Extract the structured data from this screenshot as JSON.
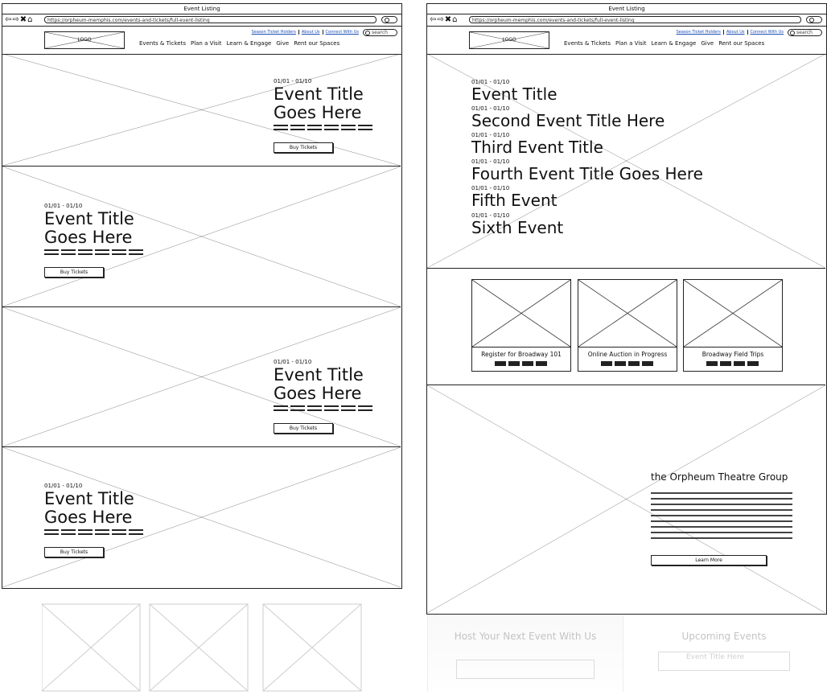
{
  "browser": {
    "title": "Event Listing",
    "left_url": "https://orpheum-memphis.com/events-and-tickets/full-event-listing",
    "right_url": "https://orpheum-memphis.com/events-and-tickets/full-event-listing"
  },
  "header": {
    "logo": "LOGO",
    "utility_links": [
      "Season Ticket Holders",
      "About Us",
      "Connect With Us"
    ],
    "search_placeholder": "search",
    "nav": [
      "Events & Tickets",
      "Plan a Visit",
      "Learn & Engage",
      "Give",
      "Rent our Spaces"
    ]
  },
  "left_events": [
    {
      "date": "01/01 - 01/10",
      "title_line1": "Event Title",
      "title_line2": "Goes Here",
      "button": "Buy Tickets"
    },
    {
      "date": "01/01 - 01/10",
      "title_line1": "Event Title",
      "title_line2": "Goes Here",
      "button": "Buy Tickets"
    },
    {
      "date": "01/01 - 01/10",
      "title_line1": "Event Title",
      "title_line2": "Goes Here",
      "button": "Buy Tickets"
    },
    {
      "date": "01/01 - 01/10",
      "title_line1": "Event Title",
      "title_line2": "Goes Here",
      "button": "Buy Tickets"
    }
  ],
  "right_event_list": [
    {
      "date": "01/01 - 01/10",
      "title": "Event Title"
    },
    {
      "date": "01/01 - 01/10",
      "title": "Second Event Title Here"
    },
    {
      "date": "01/01 - 01/10",
      "title": "Third Event Title"
    },
    {
      "date": "01/01 - 01/10",
      "title": "Fourth Event Title Goes Here"
    },
    {
      "date": "01/01 - 01/10",
      "title": "Fifth Event"
    },
    {
      "date": "01/01 - 01/10",
      "title": "Sixth Event"
    }
  ],
  "cards": [
    {
      "title": "Register for Broadway 101"
    },
    {
      "title": "Online Auction in Progress"
    },
    {
      "title": "Broadway Field Trips"
    }
  ],
  "about": {
    "heading": "the Orpheum Theatre Group",
    "button": "Learn More"
  },
  "faded_footer": {
    "host_heading": "Host Your Next Event With Us",
    "upcoming_heading": "Upcoming Events",
    "upcoming_item": "Event Title Here"
  }
}
